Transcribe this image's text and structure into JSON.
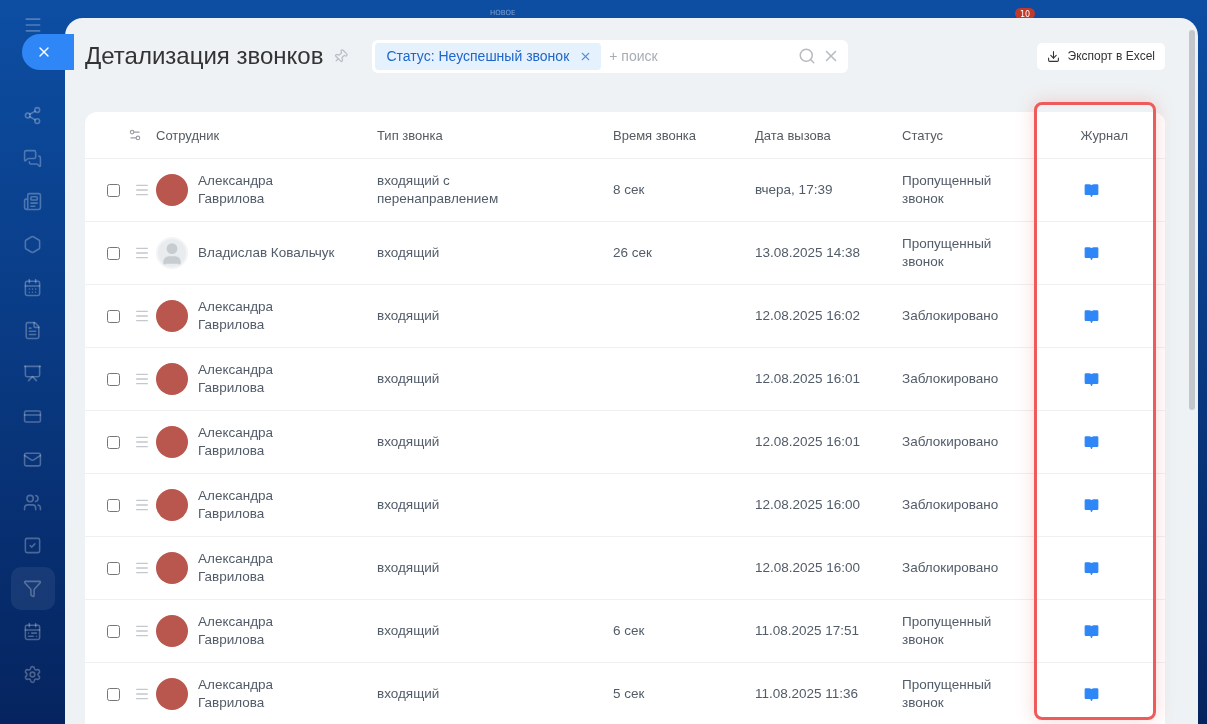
{
  "topbar": {
    "label": "НОВОЕ",
    "badge": "10"
  },
  "page": {
    "title": "Детализация звонков"
  },
  "filter": {
    "chip": "Статус: Неуспешный звонок",
    "placeholder": "+ поиск"
  },
  "export_button": "Экспорт в Excel",
  "table": {
    "columns": [
      "Сотрудник",
      "Тип звонка",
      "Время звонка",
      "Дата вызова",
      "Статус",
      "Журнал"
    ],
    "last_column_highlighted": true,
    "rows": [
      {
        "checked": false,
        "has_photo": true,
        "name": "Александра Гаврилова",
        "type": "входящий с перенаправлением",
        "duration": "8 сек",
        "date": "вчера, 17:39",
        "status": "Пропущенный звонок"
      },
      {
        "checked": false,
        "has_photo": false,
        "name": "Владислав Ковальчук",
        "type": "входящий",
        "duration": "26 сек",
        "date": "13.08.2025 14:38",
        "status": "Пропущенный звонок"
      },
      {
        "checked": false,
        "has_photo": true,
        "name": "Александра Гаврилова",
        "type": "входящий",
        "duration": "",
        "date": "12.08.2025 16:02",
        "status": "Заблокировано"
      },
      {
        "checked": false,
        "has_photo": true,
        "name": "Александра Гаврилова",
        "type": "входящий",
        "duration": "",
        "date": "12.08.2025 16:01",
        "status": "Заблокировано"
      },
      {
        "checked": false,
        "has_photo": true,
        "name": "Александра Гаврилова",
        "type": "входящий",
        "duration": "",
        "date": "12.08.2025 16:01",
        "status": "Заблокировано"
      },
      {
        "checked": false,
        "has_photo": true,
        "name": "Александра Гаврилова",
        "type": "входящий",
        "duration": "",
        "date": "12.08.2025 16:00",
        "status": "Заблокировано"
      },
      {
        "checked": false,
        "has_photo": true,
        "name": "Александра Гаврилова",
        "type": "входящий",
        "duration": "",
        "date": "12.08.2025 16:00",
        "status": "Заблокировано"
      },
      {
        "checked": false,
        "has_photo": true,
        "name": "Александра Гаврилова",
        "type": "входящий",
        "duration": "6 сек",
        "date": "11.08.2025 17:51",
        "status": "Пропущенный звонок"
      },
      {
        "checked": false,
        "has_photo": true,
        "name": "Александра Гаврилова",
        "type": "входящий",
        "duration": "5 сек",
        "date": "11.08.2025 11:36",
        "status": "Пропущенный звонок"
      }
    ]
  }
}
